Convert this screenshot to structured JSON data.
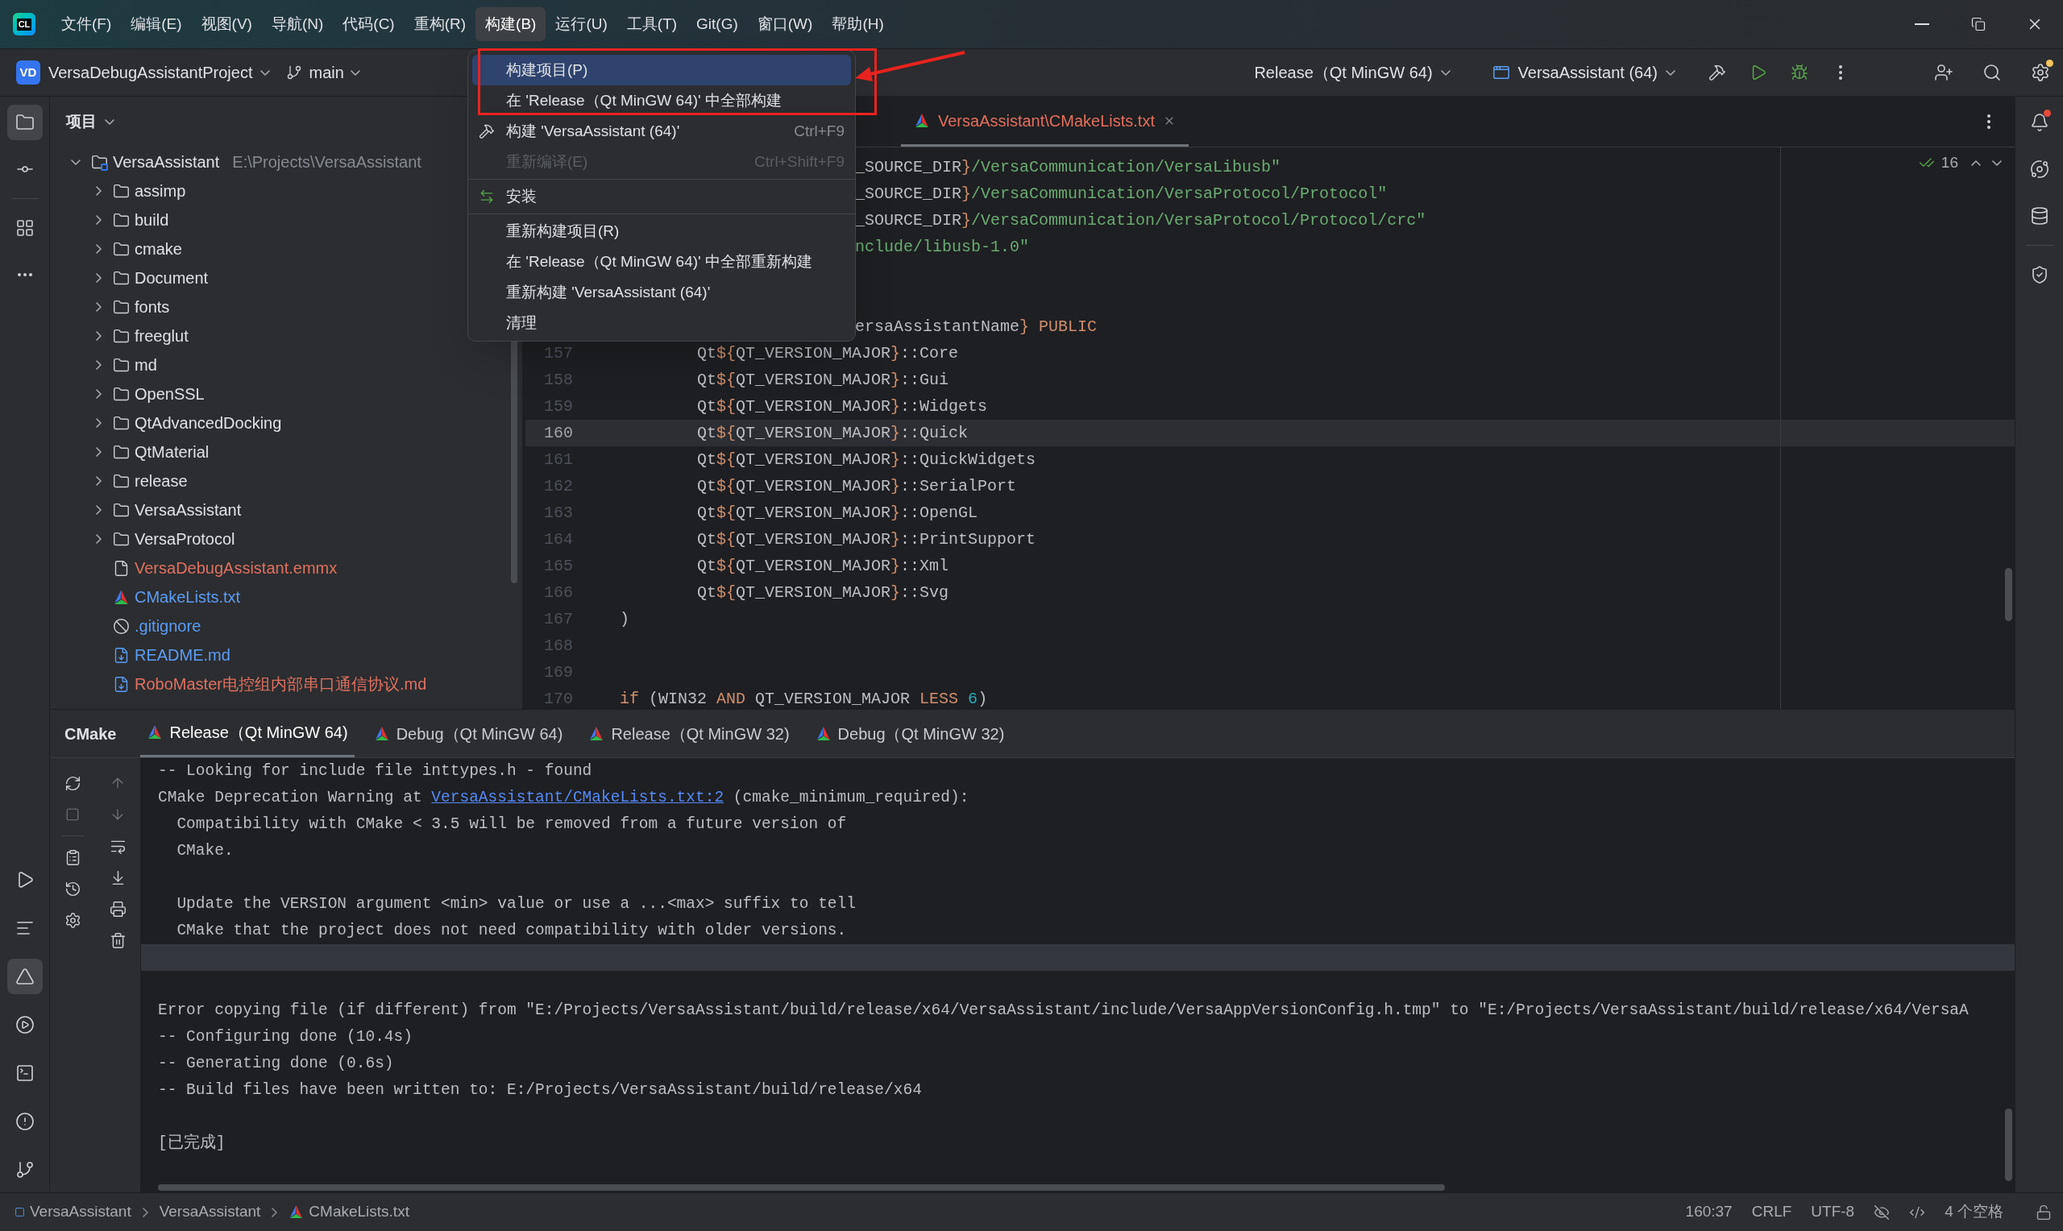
{
  "window": {
    "logo": "CL"
  },
  "menu_bar": [
    {
      "label": "文件(F)",
      "selected": false
    },
    {
      "label": "编辑(E)",
      "selected": false
    },
    {
      "label": "视图(V)",
      "selected": false
    },
    {
      "label": "导航(N)",
      "selected": false
    },
    {
      "label": "代码(C)",
      "selected": false
    },
    {
      "label": "重构(R)",
      "selected": false
    },
    {
      "label": "构建(B)",
      "selected": true
    },
    {
      "label": "运行(U)",
      "selected": false
    },
    {
      "label": "工具(T)",
      "selected": false
    },
    {
      "label": "Git(G)",
      "selected": false
    },
    {
      "label": "窗口(W)",
      "selected": false
    },
    {
      "label": "帮助(H)",
      "selected": false
    }
  ],
  "toolbar": {
    "project_badge": "VD",
    "project": "VersaDebugAssistantProject",
    "branch": "main",
    "configuration": "Release（Qt MinGW 64)",
    "run_target": "VersaAssistant (64)",
    "settings_alert": true
  },
  "left_toolbar": {
    "top": [
      {
        "kind": "project",
        "selected": true
      },
      {
        "kind": "commit",
        "selected": false
      },
      {
        "kind": "structure",
        "selected": false
      },
      {
        "kind": "more",
        "selected": false
      }
    ],
    "bottom": [
      {
        "kind": "run",
        "selected": false
      },
      {
        "kind": "todo",
        "selected": false
      },
      {
        "kind": "cmake",
        "selected": true
      },
      {
        "kind": "services",
        "selected": false
      },
      {
        "kind": "terminal",
        "selected": false
      },
      {
        "kind": "problems",
        "selected": false
      },
      {
        "kind": "git",
        "selected": false
      }
    ]
  },
  "right_toolbar": [
    {
      "kind": "notifications",
      "alert": true
    },
    {
      "kind": "assistant",
      "alert": false
    },
    {
      "kind": "database",
      "alert": false
    },
    {
      "kind": "shield",
      "alert": false
    }
  ],
  "project_panel": {
    "title": "项目",
    "tree": [
      {
        "name": "VersaAssistant",
        "path": "E:\\Projects\\VersaAssistant",
        "kind": "module",
        "expanded": true,
        "children": [
          {
            "name": "assimp",
            "kind": "folder",
            "expanded": false
          },
          {
            "name": "build",
            "kind": "folder",
            "expanded": false
          },
          {
            "name": "cmake",
            "kind": "folder",
            "expanded": false
          },
          {
            "name": "Document",
            "kind": "folder",
            "expanded": false
          },
          {
            "name": "fonts",
            "kind": "folder",
            "expanded": false
          },
          {
            "name": "freeglut",
            "kind": "folder",
            "expanded": false
          },
          {
            "name": "md",
            "kind": "folder",
            "expanded": false
          },
          {
            "name": "OpenSSL",
            "kind": "folder",
            "expanded": false
          },
          {
            "name": "QtAdvancedDocking",
            "kind": "folder",
            "expanded": false
          },
          {
            "name": "QtMaterial",
            "kind": "folder",
            "expanded": false
          },
          {
            "name": "release",
            "kind": "folder",
            "expanded": false
          },
          {
            "name": "VersaAssistant",
            "kind": "folder",
            "expanded": false
          },
          {
            "name": "VersaProtocol",
            "kind": "folder",
            "expanded": false
          },
          {
            "name": "VersaDebugAssistant.emmx",
            "kind": "unknown",
            "color": "#e0705f"
          },
          {
            "name": "CMakeLists.txt",
            "kind": "cmake",
            "color": "#5c9df5"
          },
          {
            "name": ".gitignore",
            "kind": "ignore",
            "color": "#5c9df5"
          },
          {
            "name": "README.md",
            "kind": "markdown",
            "color": "#5c9df5"
          },
          {
            "name": "RoboMaster电控组内部串口通信协议.md",
            "kind": "markdown",
            "color": "#e0705f"
          }
        ]
      }
    ]
  },
  "build_menu": [
    {
      "kind": "item",
      "label": "构建项目(P)",
      "selected": true,
      "disabled": false
    },
    {
      "kind": "item",
      "label": "在 'Release（Qt MinGW 64)' 中全部构建",
      "selected": false,
      "disabled": false
    },
    {
      "kind": "tool",
      "label": "构建 'VersaAssistant (64)'",
      "shortcut": "Ctrl+F9",
      "selected": false,
      "disabled": false
    },
    {
      "kind": "item",
      "label": "重新编译(E)",
      "shortcut": "Ctrl+Shift+F9",
      "selected": false,
      "disabled": true
    },
    {
      "kind": "separator"
    },
    {
      "kind": "install",
      "label": "安装",
      "selected": false,
      "disabled": false
    },
    {
      "kind": "separator"
    },
    {
      "kind": "item",
      "label": "重新构建项目(R)",
      "selected": false,
      "disabled": false
    },
    {
      "kind": "item",
      "label": "在 'Release（Qt MinGW 64)' 中全部重新构建",
      "selected": false,
      "disabled": false
    },
    {
      "kind": "item",
      "label": "重新构建 'VersaAssistant (64)'",
      "selected": false,
      "disabled": false
    },
    {
      "kind": "item",
      "label": "清理",
      "selected": false,
      "disabled": false
    }
  ],
  "editor": {
    "tabs": [
      {
        "label": "VersaAssistant\\CMakeLists.txt",
        "selected": true
      }
    ],
    "inspections": "16",
    "lines": [
      {
        "kind": "clipped",
        "current": false,
        "segments": [
          {
            "kind": "plain",
            "text": "_SOURCE_DIR"
          },
          {
            "kind": "keyword",
            "text": "}"
          },
          {
            "kind": "string",
            "text": "/VersaCommunication/VersaLibusb\""
          }
        ]
      },
      {
        "kind": "clipped",
        "current": false,
        "segments": [
          {
            "kind": "plain",
            "text": "_SOURCE_DIR"
          },
          {
            "kind": "keyword",
            "text": "}"
          },
          {
            "kind": "string",
            "text": "/VersaCommunication/VersaProtocol/Protocol\""
          }
        ]
      },
      {
        "kind": "clipped",
        "current": false,
        "segments": [
          {
            "kind": "plain",
            "text": "_SOURCE_DIR"
          },
          {
            "kind": "keyword",
            "text": "}"
          },
          {
            "kind": "string",
            "text": "/VersaCommunication/VersaProtocol/Protocol/crc\""
          }
        ]
      },
      {
        "kind": "clipped",
        "current": false,
        "segments": [
          {
            "kind": "string",
            "text": "nclude/libusb-1.0\""
          }
        ]
      },
      {
        "kind": "clipped",
        "current": false
      },
      {
        "kind": "clipped",
        "current": false
      },
      {
        "kind": "clipped",
        "current": false,
        "segments": [
          {
            "kind": "plain",
            "text": "ersaAssistantName"
          },
          {
            "kind": "keyword",
            "text": "} PUBLIC"
          }
        ]
      },
      {
        "kind": "code",
        "number": "157",
        "current": false,
        "segments": [
          {
            "kind": "plain",
            "text": "        Qt"
          },
          {
            "kind": "keyword",
            "text": "${"
          },
          {
            "kind": "plain",
            "text": "QT_VERSION_MAJOR"
          },
          {
            "kind": "keyword",
            "text": "}"
          },
          {
            "kind": "plain",
            "text": "::Core"
          }
        ]
      },
      {
        "kind": "code",
        "number": "158",
        "current": false,
        "segments": [
          {
            "kind": "plain",
            "text": "        Qt"
          },
          {
            "kind": "keyword",
            "text": "${"
          },
          {
            "kind": "plain",
            "text": "QT_VERSION_MAJOR"
          },
          {
            "kind": "keyword",
            "text": "}"
          },
          {
            "kind": "plain",
            "text": "::Gui"
          }
        ]
      },
      {
        "kind": "code",
        "number": "159",
        "current": false,
        "segments": [
          {
            "kind": "plain",
            "text": "        Qt"
          },
          {
            "kind": "keyword",
            "text": "${"
          },
          {
            "kind": "plain",
            "text": "QT_VERSION_MAJOR"
          },
          {
            "kind": "keyword",
            "text": "}"
          },
          {
            "kind": "plain",
            "text": "::Widgets"
          }
        ]
      },
      {
        "kind": "code",
        "number": "160",
        "current": true,
        "segments": [
          {
            "kind": "plain",
            "text": "        Qt"
          },
          {
            "kind": "keyword",
            "text": "${"
          },
          {
            "kind": "plain",
            "text": "QT_VERSION_MAJOR"
          },
          {
            "kind": "keyword",
            "text": "}"
          },
          {
            "kind": "plain",
            "text": "::Quick"
          }
        ]
      },
      {
        "kind": "code",
        "number": "161",
        "current": false,
        "segments": [
          {
            "kind": "plain",
            "text": "        Qt"
          },
          {
            "kind": "keyword",
            "text": "${"
          },
          {
            "kind": "plain",
            "text": "QT_VERSION_MAJOR"
          },
          {
            "kind": "keyword",
            "text": "}"
          },
          {
            "kind": "plain",
            "text": "::QuickWidgets"
          }
        ]
      },
      {
        "kind": "code",
        "number": "162",
        "current": false,
        "segments": [
          {
            "kind": "plain",
            "text": "        Qt"
          },
          {
            "kind": "keyword",
            "text": "${"
          },
          {
            "kind": "plain",
            "text": "QT_VERSION_MAJOR"
          },
          {
            "kind": "keyword",
            "text": "}"
          },
          {
            "kind": "plain",
            "text": "::SerialPort"
          }
        ]
      },
      {
        "kind": "code",
        "number": "163",
        "current": false,
        "segments": [
          {
            "kind": "plain",
            "text": "        Qt"
          },
          {
            "kind": "keyword",
            "text": "${"
          },
          {
            "kind": "plain",
            "text": "QT_VERSION_MAJOR"
          },
          {
            "kind": "keyword",
            "text": "}"
          },
          {
            "kind": "plain",
            "text": "::OpenGL"
          }
        ]
      },
      {
        "kind": "code",
        "number": "164",
        "current": false,
        "segments": [
          {
            "kind": "plain",
            "text": "        Qt"
          },
          {
            "kind": "keyword",
            "text": "${"
          },
          {
            "kind": "plain",
            "text": "QT_VERSION_MAJOR"
          },
          {
            "kind": "keyword",
            "text": "}"
          },
          {
            "kind": "plain",
            "text": "::PrintSupport"
          }
        ]
      },
      {
        "kind": "code",
        "number": "165",
        "current": false,
        "segments": [
          {
            "kind": "plain",
            "text": "        Qt"
          },
          {
            "kind": "keyword",
            "text": "${"
          },
          {
            "kind": "plain",
            "text": "QT_VERSION_MAJOR"
          },
          {
            "kind": "keyword",
            "text": "}"
          },
          {
            "kind": "plain",
            "text": "::Xml"
          }
        ]
      },
      {
        "kind": "code",
        "number": "166",
        "current": false,
        "segments": [
          {
            "kind": "plain",
            "text": "        Qt"
          },
          {
            "kind": "keyword",
            "text": "${"
          },
          {
            "kind": "plain",
            "text": "QT_VERSION_MAJOR"
          },
          {
            "kind": "keyword",
            "text": "}"
          },
          {
            "kind": "plain",
            "text": "::Svg"
          }
        ]
      },
      {
        "kind": "code",
        "number": "167",
        "current": false,
        "segments": [
          {
            "kind": "plain",
            "text": ")"
          }
        ]
      },
      {
        "kind": "code",
        "number": "168",
        "current": false
      },
      {
        "kind": "code",
        "number": "169",
        "current": false
      },
      {
        "kind": "code",
        "number": "170",
        "current": false,
        "segments": [
          {
            "kind": "keyword",
            "text": "if"
          },
          {
            "kind": "plain",
            "text": " (WIN32 "
          },
          {
            "kind": "keyword",
            "text": "AND"
          },
          {
            "kind": "plain",
            "text": " QT_VERSION_MAJOR "
          },
          {
            "kind": "keyword",
            "text": "LESS"
          },
          {
            "kind": "number",
            "text": " 6"
          },
          {
            "kind": "plain",
            "text": ")"
          }
        ]
      }
    ]
  },
  "bottom_panel": {
    "title": "CMake",
    "tabs": [
      {
        "label": "Release（Qt MinGW 64)",
        "selected": true
      },
      {
        "label": "Debug（Qt MinGW 64)",
        "selected": false
      },
      {
        "label": "Release（Qt MinGW 32)",
        "selected": false
      },
      {
        "label": "Debug（Qt MinGW 32)",
        "selected": false
      }
    ],
    "lines": [
      {
        "kind": "text",
        "current": false,
        "text": "-- Looking for include file inttypes.h - found"
      },
      {
        "kind": "linked",
        "current": false,
        "text": "CMake Deprecation Warning at ",
        "link": "VersaAssistant/CMakeLists.txt:2",
        "after": " (cmake_minimum_required):"
      },
      {
        "kind": "text",
        "current": false,
        "text": "  Compatibility with CMake < 3.5 will be removed from a future version of"
      },
      {
        "kind": "text",
        "current": false,
        "text": "  CMake."
      },
      {
        "kind": "blank",
        "current": false
      },
      {
        "kind": "text",
        "current": false,
        "text": "  Update the VERSION argument <min> value or use a ...<max> suffix to tell"
      },
      {
        "kind": "text",
        "current": false,
        "text": "  CMake that the project does not need compatibility with older versions."
      },
      {
        "kind": "blank",
        "current": true
      },
      {
        "kind": "blank",
        "current": false
      },
      {
        "kind": "text",
        "current": false,
        "text": "Error copying file (if different) from \"E:/Projects/VersaAssistant/build/release/x64/VersaAssistant/include/VersaAppVersionConfig.h.tmp\" to \"E:/Projects/VersaAssistant/build/release/x64/VersaA"
      },
      {
        "kind": "text",
        "current": false,
        "text": "-- Configuring done (10.4s)"
      },
      {
        "kind": "text",
        "current": false,
        "text": "-- Generating done (0.6s)"
      },
      {
        "kind": "text",
        "current": false,
        "text": "-- Build files have been written to: E:/Projects/VersaAssistant/build/release/x64"
      },
      {
        "kind": "blank",
        "current": false
      },
      {
        "kind": "text",
        "current": false,
        "text": "[已完成]"
      }
    ]
  },
  "status_bar": {
    "breadcrumbs": [
      {
        "label": "VersaAssistant",
        "kind": "module"
      },
      {
        "label": "VersaAssistant",
        "kind": "folder"
      },
      {
        "label": "CMakeLists.txt",
        "kind": "cmake"
      }
    ],
    "position": "160:37",
    "line_separator": "CRLF",
    "encoding": "UTF-8",
    "indent": "4 个空格"
  }
}
